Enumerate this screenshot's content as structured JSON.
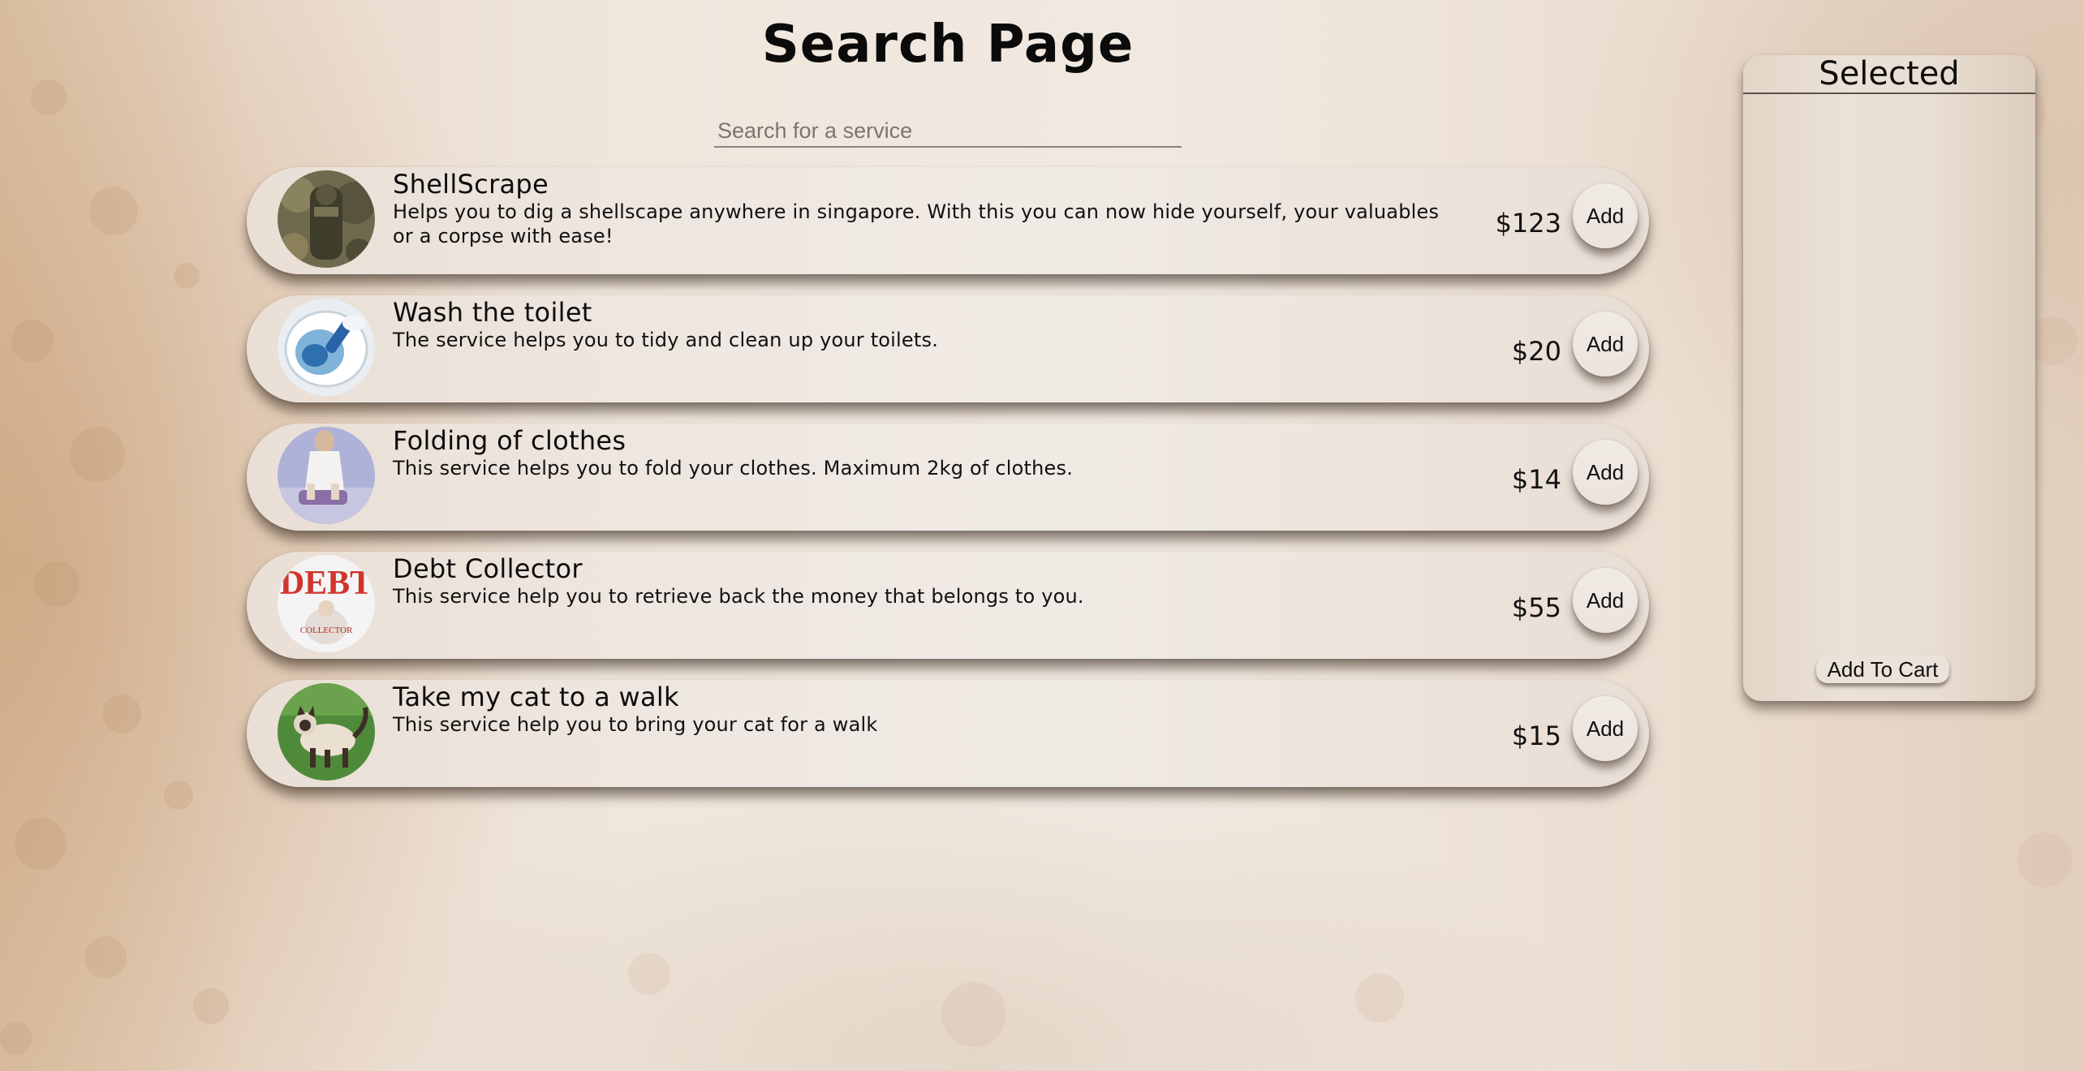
{
  "page": {
    "title": "Search Page"
  },
  "search": {
    "placeholder": "Search for a service",
    "value": ""
  },
  "services": [
    {
      "title": "ShellScrape",
      "description": "Helps you to dig a shellscape anywhere in singapore. With this you can now hide yourself, your valuables or a corpse with ease!",
      "price": "$123",
      "add_label": "Add",
      "image": "soldier-in-camouflage-photo"
    },
    {
      "title": "Wash the toilet",
      "description": "The service helps you to tidy and clean up your toilets.",
      "price": "$20",
      "add_label": "Add",
      "image": "toilet-bowl-cleaning-photo"
    },
    {
      "title": "Folding of clothes",
      "description": "This service helps you to fold your clothes. Maximum 2kg of clothes.",
      "price": "$14",
      "add_label": "Add",
      "image": "person-folding-clothes-photo"
    },
    {
      "title": "Debt Collector",
      "description": "This service help you to retrieve back the money that belongs to you.",
      "price": "$55",
      "add_label": "Add",
      "image": "debt-collector-logo-image",
      "image_text": "DEBT",
      "image_subtext": "COLLECTOR"
    },
    {
      "title": "Take my cat to a walk",
      "description": "This service help you to bring your cat for a walk",
      "price": "$15",
      "add_label": "Add",
      "image": "siamese-cat-on-grass-photo"
    }
  ],
  "selected": {
    "title": "Selected",
    "items": [],
    "add_to_cart_label": "Add To Cart"
  },
  "colors": {
    "background": "#efe6dc",
    "card": "#efe8e2",
    "text": "#111111",
    "divider": "#5a524c"
  }
}
